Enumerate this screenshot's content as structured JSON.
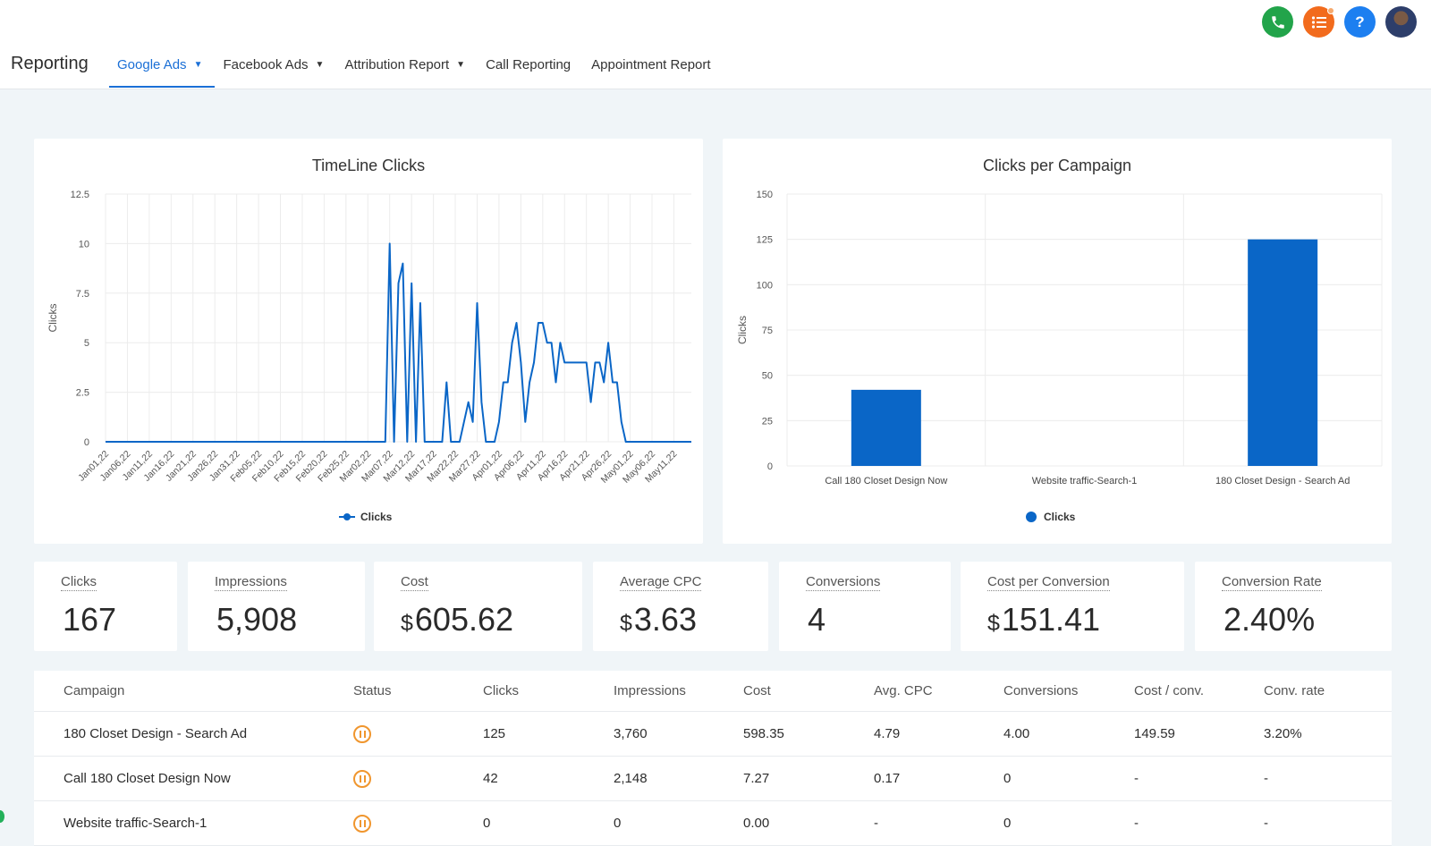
{
  "header": {
    "title": "Reporting",
    "tabs": [
      {
        "label": "Google Ads",
        "dropdown": true,
        "active": true
      },
      {
        "label": "Facebook Ads",
        "dropdown": true,
        "active": false
      },
      {
        "label": "Attribution Report",
        "dropdown": true,
        "active": false
      },
      {
        "label": "Call Reporting",
        "dropdown": false,
        "active": false
      },
      {
        "label": "Appointment Report",
        "dropdown": false,
        "active": false
      }
    ],
    "icons": [
      "phone-icon",
      "task-list-icon",
      "help-icon",
      "user-avatar"
    ],
    "help_glyph": "?"
  },
  "colors": {
    "accent": "#1a6fd6",
    "bar": "#0a66c7",
    "paused": "#f0962e"
  },
  "chart_data": [
    {
      "type": "line",
      "title": "TimeLine Clicks",
      "ylabel": "Clicks",
      "xlabel": "",
      "ylim": [
        0,
        12.5
      ],
      "yticks": [
        "12.5",
        "10",
        "7.5",
        "5",
        "2.5",
        "0"
      ],
      "x_tick_labels": [
        "Jan01,22",
        "Jan06,22",
        "Jan11,22",
        "Jan16,22",
        "Jan21,22",
        "Jan26,22",
        "Jan31,22",
        "Feb05,22",
        "Feb10,22",
        "Feb15,22",
        "Feb20,22",
        "Feb25,22",
        "Mar02,22",
        "Mar07,22",
        "Mar12,22",
        "Mar17,22",
        "Mar22,22",
        "Mar27,22",
        "Apr01,22",
        "Apr06,22",
        "Apr11,22",
        "Apr16,22",
        "Apr21,22",
        "Apr26,22",
        "May01,22",
        "May06,22",
        "May11,22"
      ],
      "series": [
        {
          "name": "Clicks",
          "points": [
            [
              "Jan01,22",
              0
            ],
            [
              "Mar06,22",
              0
            ],
            [
              "Mar07,22",
              10
            ],
            [
              "Mar08,22",
              0
            ],
            [
              "Mar09,22",
              8
            ],
            [
              "Mar10,22",
              9
            ],
            [
              "Mar11,22",
              0
            ],
            [
              "Mar12,22",
              8
            ],
            [
              "Mar13,22",
              0
            ],
            [
              "Mar14,22",
              7
            ],
            [
              "Mar15,22",
              0
            ],
            [
              "Mar16,22",
              0
            ],
            [
              "Mar17,22",
              0
            ],
            [
              "Mar18,22",
              0
            ],
            [
              "Mar19,22",
              0
            ],
            [
              "Mar20,22",
              3
            ],
            [
              "Mar21,22",
              0
            ],
            [
              "Mar22,22",
              0
            ],
            [
              "Mar23,22",
              0
            ],
            [
              "Mar24,22",
              1
            ],
            [
              "Mar25,22",
              2
            ],
            [
              "Mar26,22",
              1
            ],
            [
              "Mar27,22",
              7
            ],
            [
              "Mar28,22",
              2
            ],
            [
              "Mar29,22",
              0
            ],
            [
              "Mar30,22",
              0
            ],
            [
              "Mar31,22",
              0
            ],
            [
              "Apr01,22",
              1
            ],
            [
              "Apr02,22",
              3
            ],
            [
              "Apr03,22",
              3
            ],
            [
              "Apr04,22",
              5
            ],
            [
              "Apr05,22",
              6
            ],
            [
              "Apr06,22",
              4
            ],
            [
              "Apr07,22",
              1
            ],
            [
              "Apr08,22",
              3
            ],
            [
              "Apr09,22",
              4
            ],
            [
              "Apr10,22",
              6
            ],
            [
              "Apr11,22",
              6
            ],
            [
              "Apr12,22",
              5
            ],
            [
              "Apr13,22",
              5
            ],
            [
              "Apr14,22",
              3
            ],
            [
              "Apr15,22",
              5
            ],
            [
              "Apr16,22",
              4
            ],
            [
              "Apr17,22",
              4
            ],
            [
              "Apr18,22",
              4
            ],
            [
              "Apr19,22",
              4
            ],
            [
              "Apr20,22",
              4
            ],
            [
              "Apr21,22",
              4
            ],
            [
              "Apr22,22",
              2
            ],
            [
              "Apr23,22",
              4
            ],
            [
              "Apr24,22",
              4
            ],
            [
              "Apr25,22",
              3
            ],
            [
              "Apr26,22",
              5
            ],
            [
              "Apr27,22",
              3
            ],
            [
              "Apr28,22",
              3
            ],
            [
              "Apr29,22",
              1
            ],
            [
              "Apr30,22",
              0
            ],
            [
              "May01,22",
              0
            ],
            [
              "May15,22",
              0
            ]
          ]
        }
      ],
      "legend": [
        "Clicks"
      ],
      "legend_position": "bottom",
      "grid": true
    },
    {
      "type": "bar",
      "title": "Clicks per Campaign",
      "ylabel": "Clicks",
      "xlabel": "",
      "ylim": [
        0,
        150
      ],
      "yticks": [
        "150",
        "125",
        "100",
        "75",
        "50",
        "25",
        "0"
      ],
      "categories": [
        "Call 180 Closet Design Now",
        "Website traffic-Search-1",
        "180 Closet Design - Search Ad"
      ],
      "series": [
        {
          "name": "Clicks",
          "values": [
            42,
            0,
            125
          ]
        }
      ],
      "legend": [
        "Clicks"
      ],
      "legend_position": "bottom",
      "grid": true
    }
  ],
  "kpis": [
    {
      "label": "Clicks",
      "currency": "",
      "value": "167"
    },
    {
      "label": "Impressions",
      "currency": "",
      "value": "5,908"
    },
    {
      "label": "Cost",
      "currency": "$",
      "value": "605.62"
    },
    {
      "label": "Average CPC",
      "currency": "$",
      "value": "3.63"
    },
    {
      "label": "Conversions",
      "currency": "",
      "value": "4"
    },
    {
      "label": "Cost per Conversion",
      "currency": "$",
      "value": "151.41"
    },
    {
      "label": "Conversion Rate",
      "currency": "",
      "value": "2.40%"
    }
  ],
  "table": {
    "columns": [
      "Campaign",
      "Status",
      "Clicks",
      "Impressions",
      "Cost",
      "Avg. CPC",
      "Conversions",
      "Cost / conv.",
      "Conv. rate"
    ],
    "rows": [
      {
        "campaign": "180 Closet Design - Search Ad",
        "status": "paused",
        "clicks": "125",
        "impressions": "3,760",
        "cost": "598.35",
        "avg_cpc": "4.79",
        "conversions": "4.00",
        "cost_conv": "149.59",
        "conv_rate": "3.20%"
      },
      {
        "campaign": "Call 180 Closet Design Now",
        "status": "paused",
        "clicks": "42",
        "impressions": "2,148",
        "cost": "7.27",
        "avg_cpc": "0.17",
        "conversions": "0",
        "cost_conv": "-",
        "conv_rate": "-"
      },
      {
        "campaign": "Website traffic-Search-1",
        "status": "paused",
        "clicks": "0",
        "impressions": "0",
        "cost": "0.00",
        "avg_cpc": "-",
        "conversions": "0",
        "cost_conv": "-",
        "conv_rate": "-"
      }
    ]
  }
}
